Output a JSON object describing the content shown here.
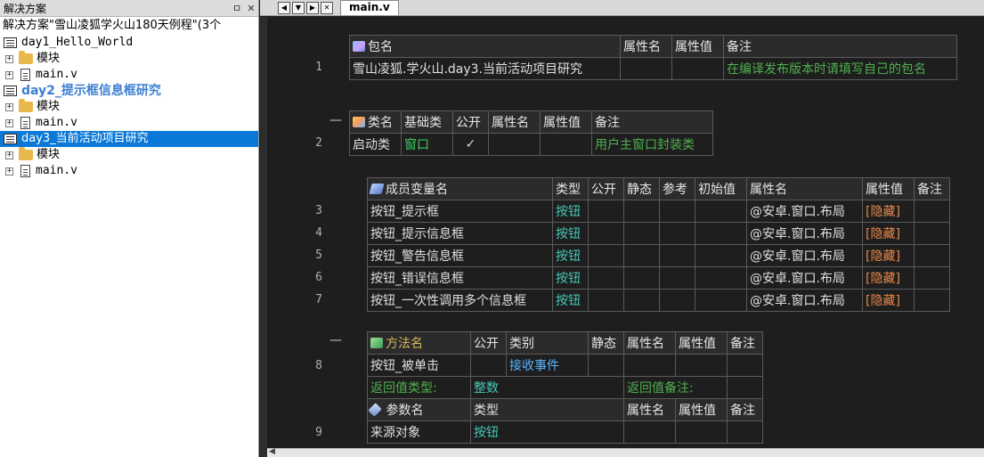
{
  "solution_panel": {
    "title": "解决方案",
    "pin_glyph": "ㅁ",
    "close_glyph": "✕",
    "root_label": "解决方案\"雪山凌狐学火山180天例程\"(3个",
    "projects": [
      {
        "label": "day1_Hello_World",
        "bold": false,
        "selected": false,
        "children": [
          {
            "type": "folder",
            "label": "模块"
          },
          {
            "type": "file",
            "label": "main.v"
          }
        ]
      },
      {
        "label": "day2_提示框信息框研究",
        "bold": true,
        "selected": false,
        "children": [
          {
            "type": "folder",
            "label": "模块"
          },
          {
            "type": "file",
            "label": "main.v"
          }
        ]
      },
      {
        "label": "day3_当前活动项目研究",
        "bold": false,
        "selected": true,
        "children": [
          {
            "type": "folder",
            "label": "模块"
          },
          {
            "type": "file",
            "label": "main.v"
          }
        ]
      }
    ]
  },
  "tab_bar": {
    "nav_buttons": [
      "◀",
      "▼",
      "▶",
      "✕"
    ],
    "active_tab": "main.v"
  },
  "editor": {
    "package": {
      "line": "1",
      "headers": [
        "包名",
        "属性名",
        "属性值",
        "备注"
      ],
      "row": [
        "雪山凌狐.学火山.day3.当前活动项目研究",
        "",
        "",
        "在编译发布版本时请填写自己的包名"
      ]
    },
    "class": {
      "line": "2",
      "collapse": "—",
      "headers": [
        "类名",
        "基础类",
        "公开",
        "属性名",
        "属性值",
        "备注"
      ],
      "row": [
        "启动类",
        "窗口",
        "✓",
        "",
        "",
        "用户主窗口封装类"
      ]
    },
    "members": {
      "headers": [
        "成员变量名",
        "类型",
        "公开",
        "静态",
        "参考",
        "初始值",
        "属性名",
        "属性值",
        "备注"
      ],
      "rows": [
        {
          "line": "3",
          "name": "按钮_提示框",
          "type": "按钮",
          "attr": "@安卓.窗口.布局",
          "value": "[隐藏]"
        },
        {
          "line": "4",
          "name": "按钮_提示信息框",
          "type": "按钮",
          "attr": "@安卓.窗口.布局",
          "value": "[隐藏]"
        },
        {
          "line": "5",
          "name": "按钮_警告信息框",
          "type": "按钮",
          "attr": "@安卓.窗口.布局",
          "value": "[隐藏]"
        },
        {
          "line": "6",
          "name": "按钮_错误信息框",
          "type": "按钮",
          "attr": "@安卓.窗口.布局",
          "value": "[隐藏]"
        },
        {
          "line": "7",
          "name": "按钮_一次性调用多个信息框",
          "type": "按钮",
          "attr": "@安卓.窗口.布局",
          "value": "[隐藏]"
        }
      ]
    },
    "method": {
      "line": "8",
      "collapse": "—",
      "headers": [
        "方法名",
        "公开",
        "类别",
        "静态",
        "属性名",
        "属性值",
        "备注"
      ],
      "row": [
        "按钮_被单击",
        "",
        "接收事件",
        "",
        "",
        "",
        ""
      ],
      "return_type_label": "返回值类型:",
      "return_type": "整数",
      "return_note_label": "返回值备注:",
      "return_note": "",
      "param_headers": [
        "参数名",
        "类型",
        "属性名",
        "属性值",
        "备注"
      ],
      "param_line": "9",
      "param_row": [
        "来源对象",
        "按钮",
        "",
        "",
        ""
      ]
    }
  }
}
